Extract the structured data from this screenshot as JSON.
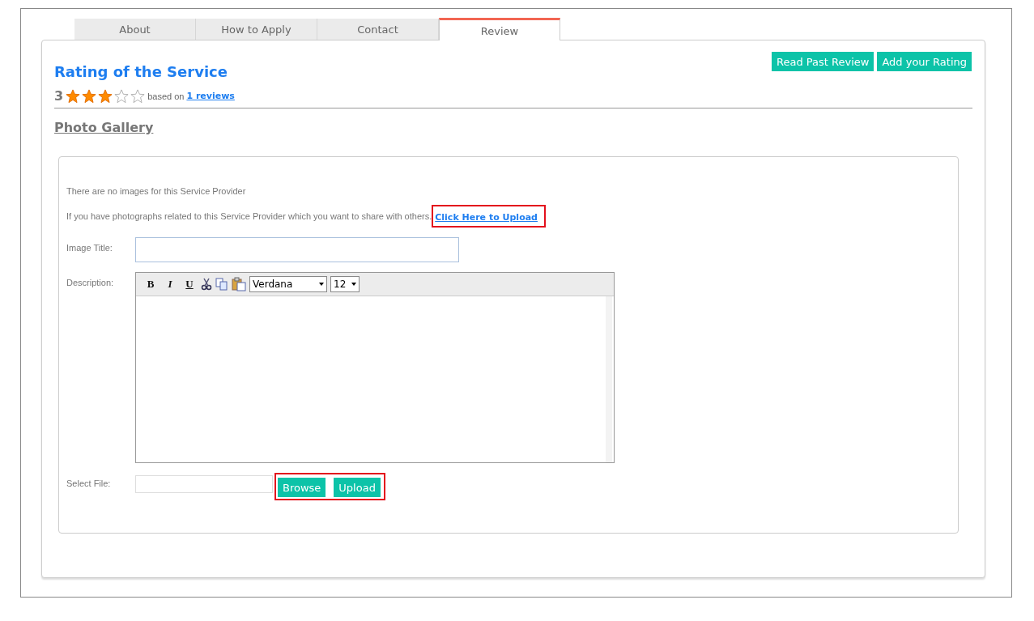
{
  "tabs": [
    {
      "label": "About",
      "selected": false
    },
    {
      "label": "How to Apply",
      "selected": false
    },
    {
      "label": "Contact",
      "selected": false
    },
    {
      "label": "Review",
      "selected": true
    }
  ],
  "rating": {
    "title": "Rating of the Service",
    "score": "3",
    "stars": 3,
    "based_on": "based on",
    "reviews_link": "1 reviews"
  },
  "actions": [
    "Read Past Review",
    "Add your Rating"
  ],
  "gallery": {
    "heading": "Photo Gallery",
    "empty_message": "There are no images for this Service Provider",
    "upload_prompt": "If you have photographs related to this Service Provider which you want to share with others.",
    "upload_link": "Click Here to Upload",
    "upload_link_highlighted": true,
    "image_title_label": "Image Title:",
    "description_label": "Description:",
    "editor": {
      "bold": "B",
      "italic": "I",
      "underline": "U",
      "font": "Verdana",
      "size": "12"
    },
    "select_file_label": "Select File:",
    "file_buttons": [
      "Browse",
      "Upload"
    ],
    "file_buttons_highlighted": true
  }
}
